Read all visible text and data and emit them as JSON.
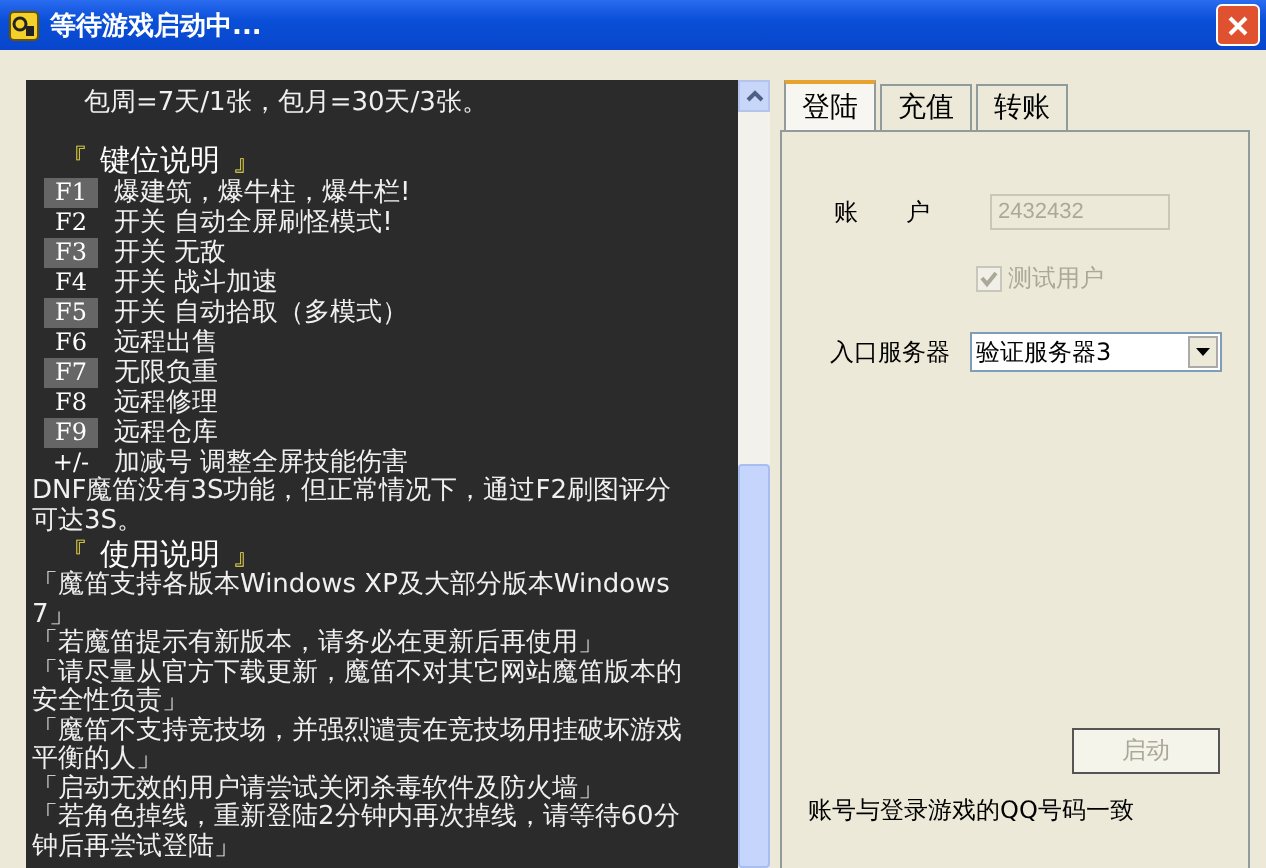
{
  "window": {
    "title": "等待游戏启动中..."
  },
  "log": {
    "intro": "包周=7天/1张，包月=30天/3张。",
    "key_section": {
      "open_mark": "『",
      "title": "键位说明",
      "close_mark": "』"
    },
    "keys": [
      {
        "key": "F1",
        "highlighted": true,
        "action": "爆建筑，爆牛柱，爆牛栏!"
      },
      {
        "key": "F2",
        "highlighted": false,
        "action": "开关 自动全屏刷怪模式!"
      },
      {
        "key": "F3",
        "highlighted": true,
        "action": "开关 无敌"
      },
      {
        "key": "F4",
        "highlighted": false,
        "action": "开关 战斗加速"
      },
      {
        "key": "F5",
        "highlighted": true,
        "action": "开关 自动拾取（多模式）"
      },
      {
        "key": "F6",
        "highlighted": false,
        "action": "远程出售"
      },
      {
        "key": "F7",
        "highlighted": true,
        "action": "无限负重"
      },
      {
        "key": "F8",
        "highlighted": false,
        "action": "远程修理"
      },
      {
        "key": "F9",
        "highlighted": true,
        "action": "远程仓库"
      },
      {
        "key": "+/-",
        "highlighted": false,
        "action": "加减号 调整全屏技能伤害"
      }
    ],
    "key_note": "DNF魔笛没有3S功能，但正常情况下，通过F2刷图评分可达3S。",
    "usage_section": {
      "open_mark": "『",
      "title": "使用说明",
      "close_mark": "』"
    },
    "usage": [
      "「魔笛支持各版本Windows XP及大部分版本Windows 7」",
      "「若魔笛提示有新版本，请务必在更新后再使用」",
      "「请尽量从官方下载更新，魔笛不对其它网站魔笛版本的安全性负责」",
      "「魔笛不支持竞技场，并强烈谴责在竞技场用挂破坏游戏平衡的人」",
      "「启动无效的用户请尝试关闭杀毒软件及防火墙」",
      "「若角色掉线，重新登陆2分钟内再次掉线，请等待60分钟后再尝试登陆」"
    ]
  },
  "tabs": [
    {
      "label": "登陆",
      "selected": true
    },
    {
      "label": "充值",
      "selected": false
    },
    {
      "label": "转账",
      "selected": false
    }
  ],
  "login": {
    "account_label": "账　　户",
    "account_value": "2432432",
    "account_disabled": true,
    "test_user": {
      "label": "测试用户",
      "checked": true,
      "disabled": true
    },
    "server_label": "入口服务器",
    "server_value": "验证服务器3",
    "start_button": {
      "label": "启动",
      "disabled": true
    },
    "note": "账号与登录游戏的QQ号码一致"
  }
}
